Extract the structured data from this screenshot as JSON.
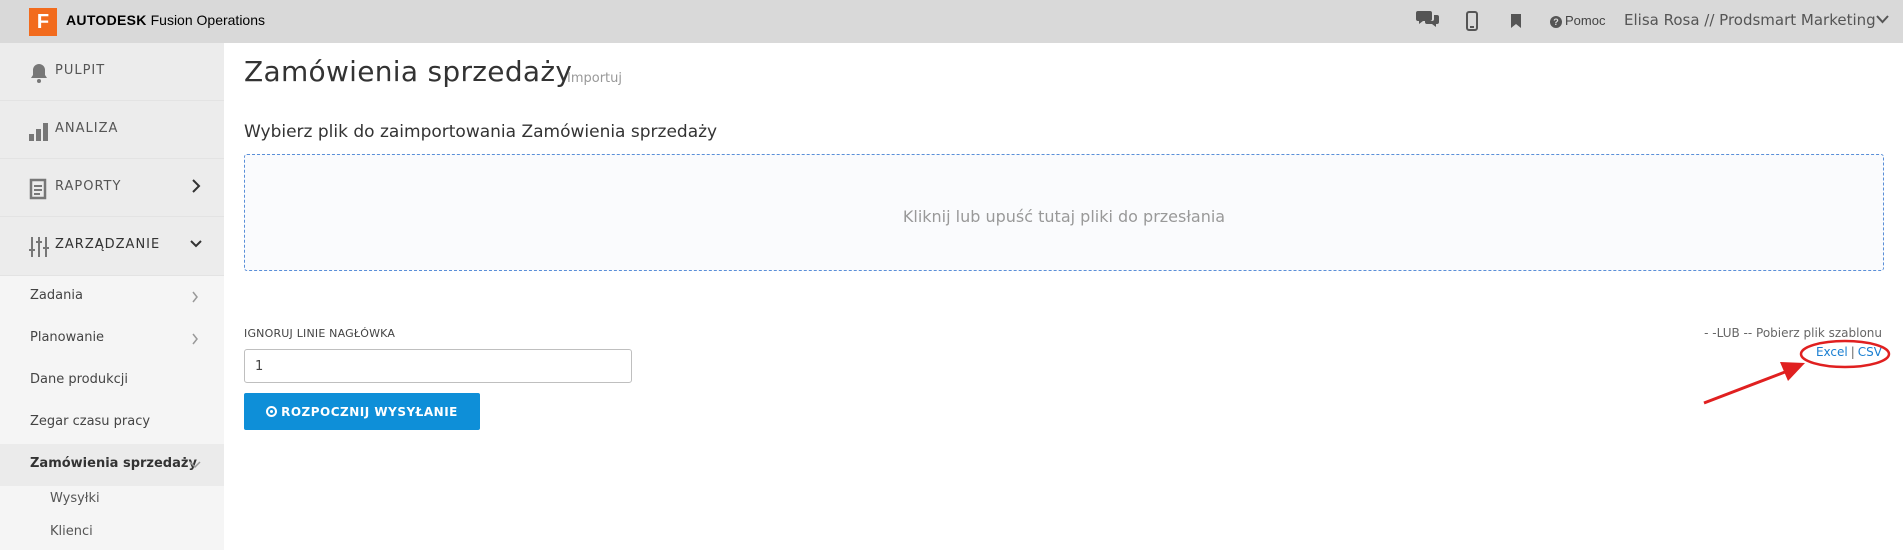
{
  "header": {
    "logo_letter": "F",
    "brand_bold": "AUTODESK",
    "brand_rest": " Fusion Operations",
    "help_label": "Pomoc",
    "user_label": "Elisa Rosa // Prodsmart Marketing",
    "icons": [
      "chat-icon",
      "mobile-icon",
      "bookmark-icon",
      "help-icon",
      "chevron-down-icon"
    ],
    "accent_color": "#f26b1d"
  },
  "sidebar": {
    "main_items": [
      {
        "label": "PULPIT",
        "icon": "bell-icon"
      },
      {
        "label": "ANALIZA",
        "icon": "bar-chart-icon"
      },
      {
        "label": "RAPORTY",
        "icon": "report-icon"
      },
      {
        "label": "ZARZĄDZANIE",
        "icon": "sliders-icon"
      }
    ],
    "sub_items": [
      {
        "label": "Zadania"
      },
      {
        "label": "Planowanie"
      },
      {
        "label": "Dane produkcji"
      },
      {
        "label": "Zegar czasu pracy"
      },
      {
        "label": "Zamówienia sprzedaży"
      }
    ],
    "leaf_items": [
      {
        "label": "Wysyłki"
      },
      {
        "label": "Klienci"
      }
    ]
  },
  "main": {
    "title": "Zamówienia sprzedaży",
    "title_tag": "Importuj",
    "section_heading": "Wybierz plik do zaimportowania Zamówienia sprzedaży",
    "dropzone_text": "Kliknij lub upuść tutaj pliki do przesłania",
    "ignore_label": "IGNORUJ LINIE NAGŁÓWKA",
    "ignore_value": "1",
    "upload_button": "ROZPOCZNIJ WYSYŁANIE",
    "template_text": "- -LUB -- Pobierz plik szablonu",
    "excel_link": "Excel",
    "link_separator": "|",
    "csv_link": "CSV",
    "button_color": "#0e8fd8",
    "annotation_color": "#e02020"
  }
}
